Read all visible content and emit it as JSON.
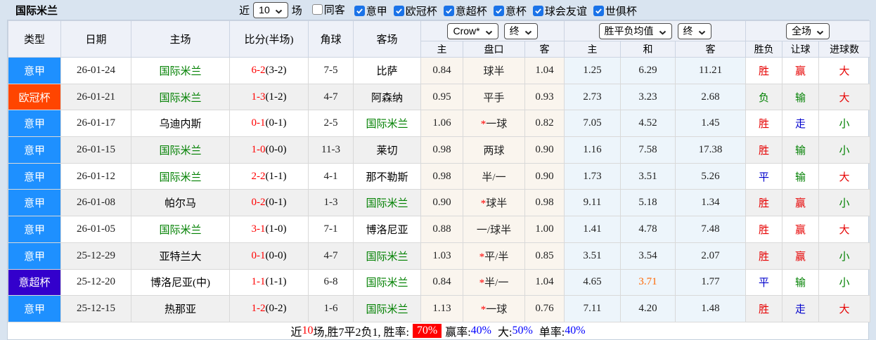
{
  "title": "国际米兰",
  "topbar": {
    "recent_prefix": "近",
    "recent_count": "10",
    "recent_suffix": "场",
    "checkboxes": [
      {
        "label": "同客",
        "checked": false
      },
      {
        "label": "意甲",
        "checked": true
      },
      {
        "label": "欧冠杯",
        "checked": true
      },
      {
        "label": "意超杯",
        "checked": true
      },
      {
        "label": "意杯",
        "checked": true
      },
      {
        "label": "球会友谊",
        "checked": true
      },
      {
        "label": "世俱杯",
        "checked": true
      }
    ],
    "checkbox_accent": "#1a73e8"
  },
  "table": {
    "main_headers": [
      "类型",
      "日期",
      "主场",
      "比分(半场)",
      "角球",
      "客场"
    ],
    "selects": {
      "company": "Crow*",
      "company_time": "终",
      "avg": "胜平负均值",
      "avg_time": "终",
      "scope": "全场"
    },
    "sub_headers": [
      "主",
      "盘口",
      "客",
      "主",
      "和",
      "客",
      "胜负",
      "让球",
      "进球数"
    ],
    "rows": [
      {
        "type": "意甲",
        "type_color": "#1e90ff",
        "date": "26-01-24",
        "home": "国际米兰",
        "home_color": "#008000",
        "score": "6-2",
        "half": "(3-2)",
        "corners": "7-5",
        "away": "比萨",
        "away_color": "#000000",
        "crow": {
          "home": "0.84",
          "star": "",
          "line": "球半",
          "away": "1.04"
        },
        "avg": {
          "home": "1.25",
          "draw": "6.29",
          "draw_color": "#222222",
          "away": "11.21"
        },
        "result": {
          "outcome": "胜",
          "outcome_color": "#e60000",
          "handicap": "赢",
          "handicap_color": "#e60000",
          "goals": "大",
          "goals_color": "#e60000"
        }
      },
      {
        "type": "欧冠杯",
        "type_color": "#ff4500",
        "date": "26-01-21",
        "home": "国际米兰",
        "home_color": "#008000",
        "score": "1-3",
        "half": "(1-2)",
        "corners": "4-7",
        "away": "阿森纳",
        "away_color": "#000000",
        "crow": {
          "home": "0.95",
          "star": "",
          "line": "平手",
          "away": "0.93"
        },
        "avg": {
          "home": "2.73",
          "draw": "3.23",
          "draw_color": "#222222",
          "away": "2.68"
        },
        "result": {
          "outcome": "负",
          "outcome_color": "#008000",
          "handicap": "输",
          "handicap_color": "#008000",
          "goals": "大",
          "goals_color": "#e60000"
        }
      },
      {
        "type": "意甲",
        "type_color": "#1e90ff",
        "date": "26-01-17",
        "home": "乌迪内斯",
        "home_color": "#000000",
        "score": "0-1",
        "half": "(0-1)",
        "corners": "2-5",
        "away": "国际米兰",
        "away_color": "#008000",
        "crow": {
          "home": "1.06",
          "star": "*",
          "line": "一球",
          "away": "0.82"
        },
        "avg": {
          "home": "7.05",
          "draw": "4.52",
          "draw_color": "#222222",
          "away": "1.45"
        },
        "result": {
          "outcome": "胜",
          "outcome_color": "#e60000",
          "handicap": "走",
          "handicap_color": "#0000cc",
          "goals": "小",
          "goals_color": "#008000"
        }
      },
      {
        "type": "意甲",
        "type_color": "#1e90ff",
        "date": "26-01-15",
        "home": "国际米兰",
        "home_color": "#008000",
        "score": "1-0",
        "half": "(0-0)",
        "corners": "11-3",
        "away": "莱切",
        "away_color": "#000000",
        "crow": {
          "home": "0.98",
          "star": "",
          "line": "两球",
          "away": "0.90"
        },
        "avg": {
          "home": "1.16",
          "draw": "7.58",
          "draw_color": "#222222",
          "away": "17.38"
        },
        "result": {
          "outcome": "胜",
          "outcome_color": "#e60000",
          "handicap": "输",
          "handicap_color": "#008000",
          "goals": "小",
          "goals_color": "#008000"
        }
      },
      {
        "type": "意甲",
        "type_color": "#1e90ff",
        "date": "26-01-12",
        "home": "国际米兰",
        "home_color": "#008000",
        "score": "2-2",
        "half": "(1-1)",
        "corners": "4-1",
        "away": "那不勒斯",
        "away_color": "#000000",
        "crow": {
          "home": "0.98",
          "star": "",
          "line": "半/一",
          "away": "0.90"
        },
        "avg": {
          "home": "1.73",
          "draw": "3.51",
          "draw_color": "#222222",
          "away": "5.26"
        },
        "result": {
          "outcome": "平",
          "outcome_color": "#0000cc",
          "handicap": "输",
          "handicap_color": "#008000",
          "goals": "大",
          "goals_color": "#e60000"
        }
      },
      {
        "type": "意甲",
        "type_color": "#1e90ff",
        "date": "26-01-08",
        "home": "帕尔马",
        "home_color": "#000000",
        "score": "0-2",
        "half": "(0-1)",
        "corners": "1-3",
        "away": "国际米兰",
        "away_color": "#008000",
        "crow": {
          "home": "0.90",
          "star": "*",
          "line": "球半",
          "away": "0.98"
        },
        "avg": {
          "home": "9.11",
          "draw": "5.18",
          "draw_color": "#222222",
          "away": "1.34"
        },
        "result": {
          "outcome": "胜",
          "outcome_color": "#e60000",
          "handicap": "赢",
          "handicap_color": "#e60000",
          "goals": "小",
          "goals_color": "#008000"
        }
      },
      {
        "type": "意甲",
        "type_color": "#1e90ff",
        "date": "26-01-05",
        "home": "国际米兰",
        "home_color": "#008000",
        "score": "3-1",
        "half": "(1-0)",
        "corners": "7-1",
        "away": "博洛尼亚",
        "away_color": "#000000",
        "crow": {
          "home": "0.88",
          "star": "",
          "line": "一/球半",
          "away": "1.00"
        },
        "avg": {
          "home": "1.41",
          "draw": "4.78",
          "draw_color": "#222222",
          "away": "7.48"
        },
        "result": {
          "outcome": "胜",
          "outcome_color": "#e60000",
          "handicap": "赢",
          "handicap_color": "#e60000",
          "goals": "大",
          "goals_color": "#e60000"
        }
      },
      {
        "type": "意甲",
        "type_color": "#1e90ff",
        "date": "25-12-29",
        "home": "亚特兰大",
        "home_color": "#000000",
        "score": "0-1",
        "half": "(0-0)",
        "corners": "4-7",
        "away": "国际米兰",
        "away_color": "#008000",
        "crow": {
          "home": "1.03",
          "star": "*",
          "line": "平/半",
          "away": "0.85"
        },
        "avg": {
          "home": "3.51",
          "draw": "3.54",
          "draw_color": "#222222",
          "away": "2.07"
        },
        "result": {
          "outcome": "胜",
          "outcome_color": "#e60000",
          "handicap": "赢",
          "handicap_color": "#e60000",
          "goals": "小",
          "goals_color": "#008000"
        }
      },
      {
        "type": "意超杯",
        "type_color": "#3300cc",
        "date": "25-12-20",
        "home": "博洛尼亚(中)",
        "home_color": "#000000",
        "score": "1-1",
        "half": "(1-1)",
        "corners": "6-8",
        "away": "国际米兰",
        "away_color": "#008000",
        "crow": {
          "home": "0.84",
          "star": "*",
          "line": "半/一",
          "away": "1.04"
        },
        "avg": {
          "home": "4.65",
          "draw": "3.71",
          "draw_color": "#ff6600",
          "away": "1.77"
        },
        "result": {
          "outcome": "平",
          "outcome_color": "#0000cc",
          "handicap": "输",
          "handicap_color": "#008000",
          "goals": "小",
          "goals_color": "#008000"
        }
      },
      {
        "type": "意甲",
        "type_color": "#1e90ff",
        "date": "25-12-15",
        "home": "热那亚",
        "home_color": "#000000",
        "score": "1-2",
        "half": "(0-2)",
        "corners": "1-6",
        "away": "国际米兰",
        "away_color": "#008000",
        "crow": {
          "home": "1.13",
          "star": "*",
          "line": "一球",
          "away": "0.76"
        },
        "avg": {
          "home": "7.11",
          "draw": "4.20",
          "draw_color": "#222222",
          "away": "1.48"
        },
        "result": {
          "outcome": "胜",
          "outcome_color": "#e60000",
          "handicap": "走",
          "handicap_color": "#0000cc",
          "goals": "大",
          "goals_color": "#e60000"
        }
      }
    ]
  },
  "footer": {
    "seg_recent": "近",
    "recent_count": "10",
    "seg_summary": "场,胜7平2负1, 胜率:",
    "win_rate": "70%",
    "seg_handicap": "赢率:",
    "handicap_rate": "40%",
    "seg_big": "大:",
    "big_rate": "50%",
    "seg_single": "单率:",
    "single_rate": "40%"
  },
  "colors": {
    "page_background": "#d9e4f0",
    "header_background": "#eef1f8",
    "stripe": "#f0f0f0",
    "crow_tint": "#faf5ee",
    "avg_tint": "#edf5fb",
    "badge_league": "#1e90ff",
    "badge_ucl": "#ff4500",
    "badge_supercup": "#3300cc",
    "rate_badge": "#ff0000",
    "footer_value_blue": "#0000ff"
  }
}
